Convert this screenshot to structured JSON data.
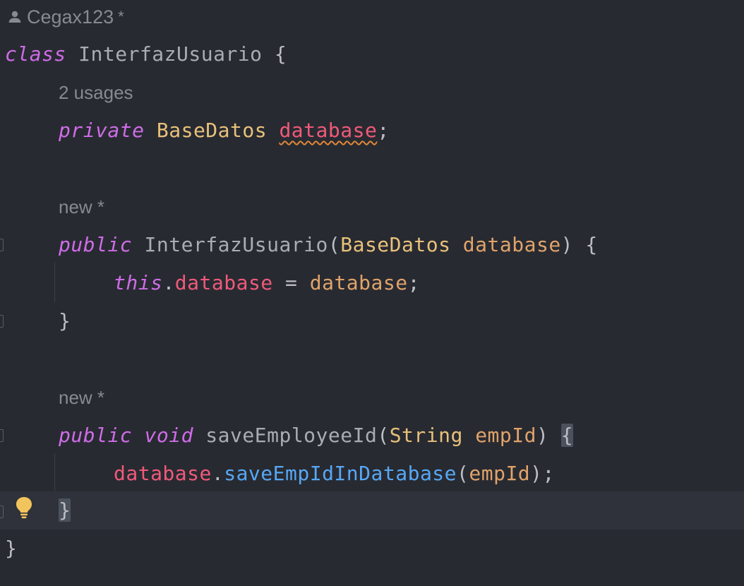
{
  "author": {
    "name": "Cegax123",
    "modified_marker": "*"
  },
  "hints": {
    "usages": "2 usages",
    "new_constructor": "new *",
    "new_method": "new *"
  },
  "code": {
    "line1": {
      "kw": "class",
      "name": " InterfazUsuario ",
      "brace": "{"
    },
    "line2": {
      "kw": "private",
      "type": " BaseDatos ",
      "field": "database",
      "end": ";"
    },
    "line3": {
      "kw": "public",
      "name": " InterfazUsuario",
      "open": "(",
      "type": "BaseDatos",
      "param": " database",
      "close": ") {"
    },
    "line4": {
      "this": "this",
      "dot": ".",
      "field": "database",
      "eq": " = ",
      "param": "database",
      "end": ";"
    },
    "line5": {
      "brace": "}"
    },
    "line6": {
      "kw1": "public",
      "kw2": " void",
      "name": " saveEmployeeId",
      "open": "(",
      "type": "String",
      "param": " empId",
      "close": ") ",
      "brace": "{"
    },
    "line7": {
      "field": "database",
      "dot": ".",
      "method": "saveEmpIdInDatabase",
      "open": "(",
      "param": "empId",
      "close": ");"
    },
    "line8": {
      "brace": "}"
    },
    "line9": {
      "brace": "}"
    }
  },
  "colors": {
    "background": "#282a31",
    "keyword": "#cf6ce8",
    "class": "#e8c17a",
    "field": "#ef5a7a",
    "parameter": "#e0a36a",
    "method_call": "#56a8f5",
    "hint": "#868a91",
    "bulb": "#f2c55c"
  }
}
